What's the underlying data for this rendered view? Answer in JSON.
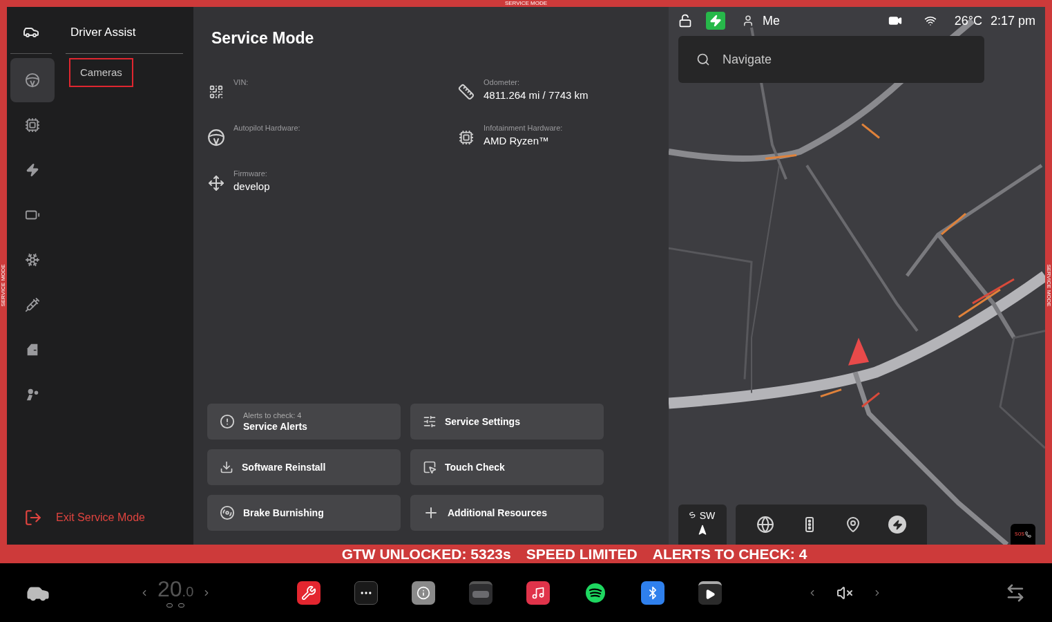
{
  "frame_labels": {
    "top": "SERVICE MODE",
    "left": "SERVICE MODE",
    "right": "SERVICE MODE"
  },
  "rail": {
    "items": [
      {
        "kind": "steering",
        "selected": true
      },
      {
        "kind": "chip",
        "selected": false
      },
      {
        "kind": "bolt",
        "selected": false
      },
      {
        "kind": "battery",
        "selected": false
      },
      {
        "kind": "snowflake",
        "selected": false
      },
      {
        "kind": "syringe",
        "selected": false
      },
      {
        "kind": "door",
        "selected": false
      },
      {
        "kind": "airbag",
        "selected": false
      }
    ]
  },
  "section": {
    "title": "Driver Assist",
    "items": [
      {
        "label": "Cameras",
        "selected": true
      }
    ]
  },
  "exit": {
    "label": "Exit Service Mode"
  },
  "content": {
    "title": "Service Mode",
    "info": [
      {
        "kind": "qr",
        "label": "VIN:"
      },
      {
        "kind": "ruler",
        "label": "Odometer:",
        "value": "4811.264 mi / 7743 km"
      },
      {
        "kind": "steering",
        "label": "Autopilot Hardware:"
      },
      {
        "kind": "chip",
        "label": "Infotainment Hardware:",
        "value": "AMD Ryzen™"
      },
      {
        "kind": "firmware",
        "label": "Firmware:",
        "value": "develop"
      }
    ],
    "buttons": [
      {
        "kind": "alert",
        "subtitle": "Alerts to check: 4",
        "label": "Service Alerts"
      },
      {
        "kind": "sliders",
        "label": "Service Settings"
      },
      {
        "kind": "download",
        "label": "Software Reinstall"
      },
      {
        "kind": "touch",
        "label": "Touch Check"
      },
      {
        "kind": "brake",
        "label": "Brake Burnishing"
      },
      {
        "kind": "plus",
        "label": "Additional Resources"
      }
    ]
  },
  "status": {
    "charging": true,
    "user": "Me",
    "temperature": "26°C",
    "time": "2:17 pm"
  },
  "search": {
    "placeholder": "Navigate"
  },
  "compass": {
    "left": "S",
    "heading": "SW"
  },
  "map_controls": [
    {
      "kind": "globe"
    },
    {
      "kind": "traffic"
    },
    {
      "kind": "pin"
    },
    {
      "kind": "charger"
    }
  ],
  "sos": {
    "label": "sos"
  },
  "alert_band": [
    "GTW UNLOCKED: 5323s",
    "SPEED LIMITED",
    "ALERTS TO CHECK: 4"
  ],
  "taskbar": {
    "temperature": "20",
    "temperature_decimal": ".0",
    "apps": [
      {
        "kind": "service"
      },
      {
        "kind": "more"
      },
      {
        "kind": "manual"
      },
      {
        "kind": "dashcam"
      },
      {
        "kind": "music"
      },
      {
        "kind": "spotify"
      },
      {
        "kind": "bluetooth"
      },
      {
        "kind": "video"
      }
    ],
    "muted": true
  }
}
